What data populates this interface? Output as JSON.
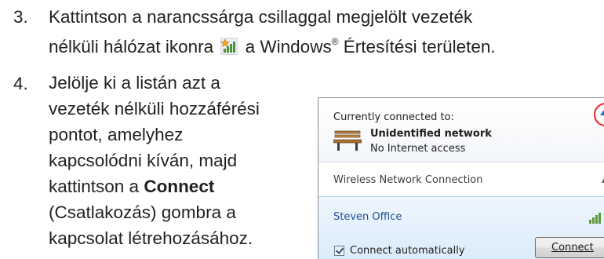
{
  "steps": [
    {
      "number": "3.",
      "line1": "Kattintson a narancssárga csillaggal megjelölt vezeték",
      "line2_before_icon": "nélküli hálózat ikonra",
      "icon": "wireless-network-star-icon",
      "line2_after_icon": "a Windows",
      "registered_mark": "®",
      "line2_end": " Értesítési területen."
    },
    {
      "number": "4.",
      "lines": [
        "Jelölje ki a listán azt a",
        "vezeték nélküli hozzáférési",
        "pontot, amelyhez",
        "kapcsolódni kíván, majd",
        "kattintson a ",
        "(Csatlakozás) gombra a",
        "kapcsolat létrehozásához."
      ],
      "bold_word": "Connect"
    }
  ],
  "popup": {
    "currently_connected_label": "Currently connected to:",
    "network_icon": "bench-network-icon",
    "network_name": "Unidentified network",
    "network_status": "No Internet access",
    "section_label": "Wireless Network Connection",
    "selected_network": "Steven Office",
    "auto_connect_label": "Connect automatically",
    "auto_connect_checked": true,
    "connect_button_label": "Connect",
    "highlight_color": "#e2252a",
    "accent_color": "#1e4f91"
  }
}
